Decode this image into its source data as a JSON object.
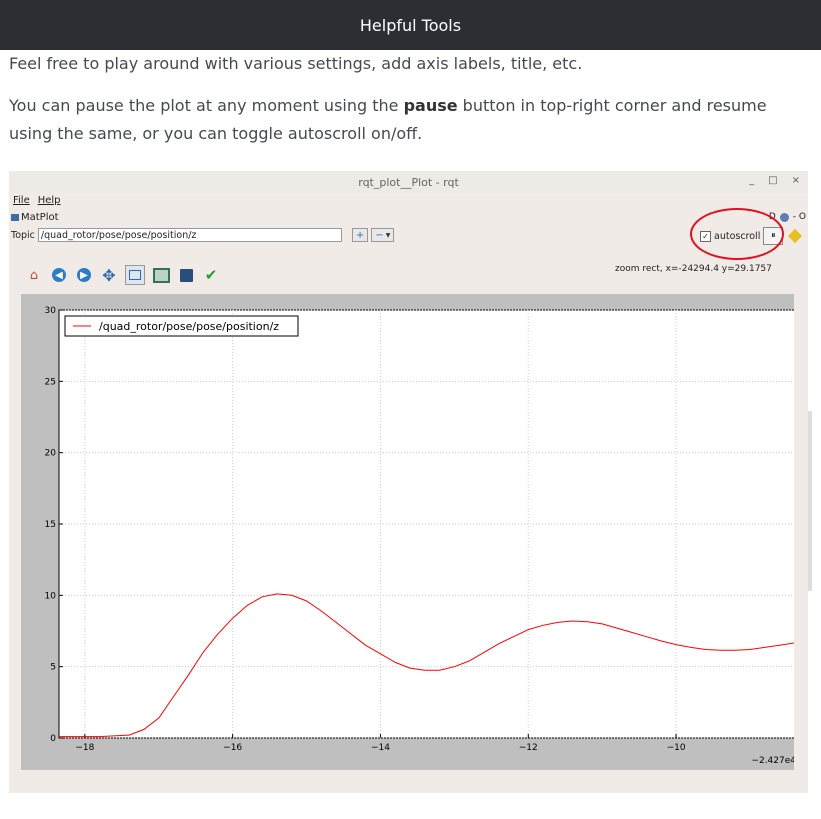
{
  "page": {
    "title": "Helpful Tools",
    "para1": "Feel free to play around with various settings, add axis labels, title, etc.",
    "para2_before": "You can pause the plot at any moment using the ",
    "para2_bold": "pause",
    "para2_after": " button in top-right corner and resume using the same, or you can toggle autoscroll on/off."
  },
  "window": {
    "title": "rqt_plot__Plot - rqt",
    "minimize": "_",
    "maximize": "□",
    "close": "×",
    "menu": {
      "file": "File",
      "help": "Help"
    },
    "plugin_label": "MatPlot",
    "plugin_right": "D",
    "plugin_right2": "- O",
    "topic_label": "Topic",
    "topic_value": "/quad_rotor/pose/pose/position/z",
    "add_button": "+",
    "remove_button": "−",
    "autoscroll_label": "autoscroll",
    "autoscroll_checked": "✓",
    "pause_icon": "⏸",
    "coord_readout": "zoom rect, x=-24294.4    y=29.1757",
    "toolbar_icons": [
      "home-icon",
      "back-icon",
      "forward-icon",
      "pan-icon",
      "zoom-icon",
      "configure-icon",
      "save-icon",
      "check-icon"
    ]
  },
  "chart_data": {
    "type": "line",
    "title": "",
    "xlabel": "",
    "ylabel": "",
    "x_offset_label": "−2.427e4",
    "xlim": [
      -18.35,
      -8.35
    ],
    "ylim": [
      0,
      30
    ],
    "xticks": [
      -18,
      -16,
      -14,
      -12,
      -10
    ],
    "yticks": [
      0,
      5,
      10,
      15,
      20,
      25,
      30
    ],
    "grid": true,
    "legend_position": "top-left",
    "series": [
      {
        "name": "/quad_rotor/pose/pose/position/z",
        "color": "#ff0000",
        "x": [
          -18.35,
          -17.8,
          -17.4,
          -17.2,
          -17.0,
          -16.8,
          -16.6,
          -16.4,
          -16.2,
          -16.0,
          -15.8,
          -15.6,
          -15.4,
          -15.2,
          -15.0,
          -14.8,
          -14.6,
          -14.4,
          -14.2,
          -14.0,
          -13.8,
          -13.6,
          -13.4,
          -13.2,
          -13.0,
          -12.8,
          -12.6,
          -12.4,
          -12.2,
          -12.0,
          -11.8,
          -11.6,
          -11.4,
          -11.2,
          -11.0,
          -10.8,
          -10.6,
          -10.4,
          -10.2,
          -10.0,
          -9.8,
          -9.6,
          -9.4,
          -9.2,
          -9.0,
          -8.8,
          -8.6,
          -8.35
        ],
        "y": [
          0.1,
          0.1,
          0.2,
          0.6,
          1.4,
          2.9,
          4.4,
          6.0,
          7.3,
          8.4,
          9.3,
          9.9,
          10.1,
          10.0,
          9.6,
          8.9,
          8.1,
          7.3,
          6.5,
          5.9,
          5.3,
          4.9,
          4.75,
          4.75,
          5.0,
          5.4,
          6.0,
          6.6,
          7.1,
          7.6,
          7.9,
          8.1,
          8.2,
          8.15,
          8.0,
          7.7,
          7.4,
          7.1,
          6.8,
          6.55,
          6.35,
          6.2,
          6.15,
          6.15,
          6.2,
          6.35,
          6.5,
          6.7
        ]
      }
    ]
  },
  "colors": {
    "topbar_bg": "#2b2f33",
    "annotation_circle": "#e01020",
    "plot_line": "#ff0000"
  }
}
